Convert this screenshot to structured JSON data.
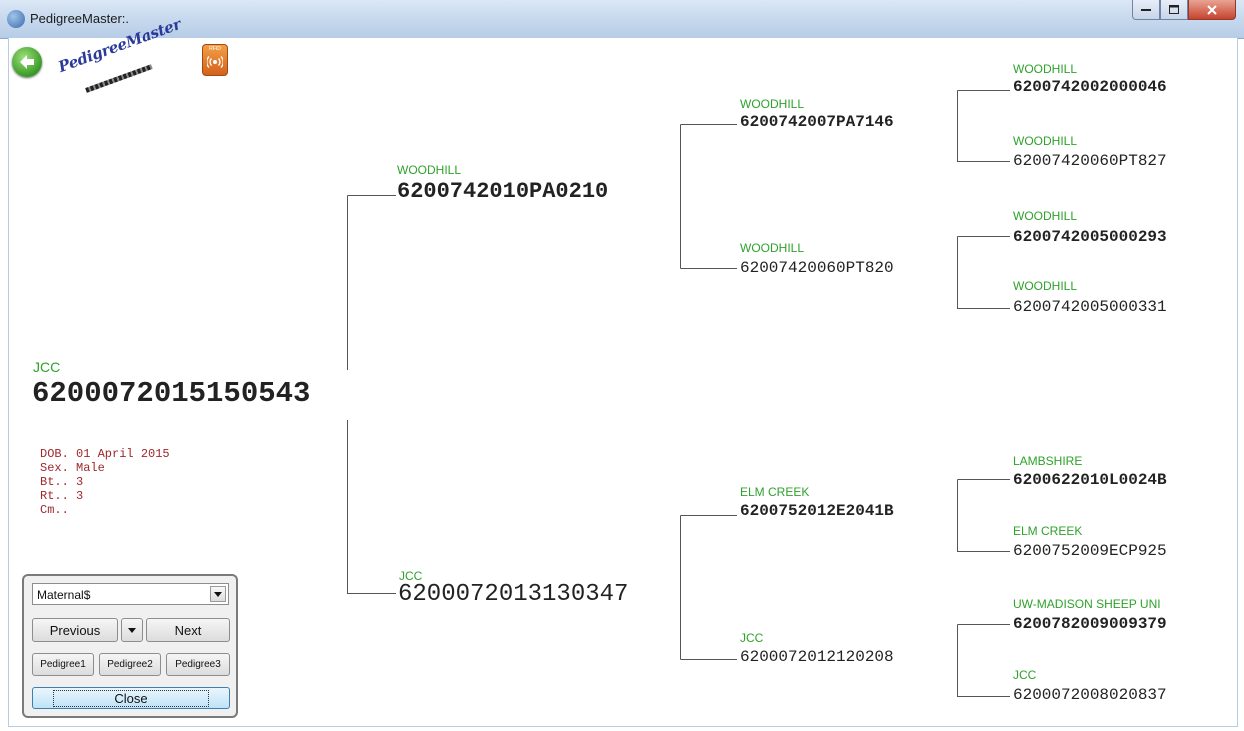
{
  "window": {
    "title": "PedigreeMaster:."
  },
  "logo": {
    "text": "PedigreeMaster",
    "rfid_label": "RFID"
  },
  "subject": {
    "farm": "JCC",
    "tag": "6200072015150543"
  },
  "info": {
    "dob": "DOB. 01 April 2015",
    "sex": "Sex. Male",
    "bt": "Bt.. 3",
    "rt": "Rt.. 3",
    "cm": "Cm.."
  },
  "tree": {
    "sire": {
      "farm": "WOODHILL",
      "tag": "6200742010PA0210"
    },
    "dam": {
      "farm": "JCC",
      "tag": "6200072013130347"
    },
    "gen2": [
      {
        "farm": "WOODHILL",
        "tag": "6200742007PA7146"
      },
      {
        "farm": "WOODHILL",
        "tag": "62007420060PT820"
      },
      {
        "farm": "ELM CREEK",
        "tag": "6200752012E2041B"
      },
      {
        "farm": "JCC",
        "tag": "6200072012120208"
      }
    ],
    "gen3": [
      {
        "farm": "WOODHILL",
        "tag": "6200742002000046"
      },
      {
        "farm": "WOODHILL",
        "tag": "62007420060PT827"
      },
      {
        "farm": "WOODHILL",
        "tag": "6200742005000293"
      },
      {
        "farm": "WOODHILL",
        "tag": "6200742005000331"
      },
      {
        "farm": "LAMBSHIRE",
        "tag": "6200622010L0024B"
      },
      {
        "farm": "ELM CREEK",
        "tag": "6200752009ECP925"
      },
      {
        "farm": "UW-MADISON SHEEP UNI",
        "tag": "6200782009009379"
      },
      {
        "farm": "JCC",
        "tag": "6200072008020837"
      }
    ]
  },
  "panel": {
    "dropdown_value": "Maternal$",
    "previous": "Previous",
    "next": "Next",
    "pedigree1": "Pedigree1",
    "pedigree2": "Pedigree2",
    "pedigree3": "Pedigree3",
    "close": "Close"
  }
}
